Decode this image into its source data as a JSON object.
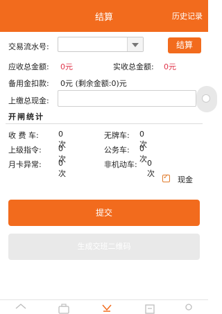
{
  "header": {
    "title": "结算",
    "history": "历史记录"
  },
  "form": {
    "txn_label": "交易流水号:",
    "settle_button": "结算",
    "receivable_label": "应收总金额:",
    "receivable_value": "0元",
    "received_label": "实收总金额:",
    "received_value": "0元",
    "reserve_label": "备用金扣款:",
    "reserve_value": "0元 (剩余金额:0)元",
    "cash_label": "上缴总现金:"
  },
  "stats": {
    "title": "开闸统计",
    "items": [
      {
        "label": "收 费 车:",
        "value": "0次"
      },
      {
        "label": "无牌车:",
        "value": "0次"
      },
      {
        "label": "上级指令:",
        "value": "0次"
      },
      {
        "label": "公务车:",
        "value": "0次"
      },
      {
        "label": "月卡异常:",
        "value": "0次"
      },
      {
        "label": "非机动车:",
        "value": "0次"
      }
    ]
  },
  "cash_checkbox": {
    "label": "现金",
    "checked": true
  },
  "buttons": {
    "submit": "提交",
    "qrcode": "生成交班二维码"
  },
  "tabbar": {
    "icons": [
      "home-icon",
      "camera-icon",
      "settlement-icon",
      "calendar-icon",
      "user-icon"
    ]
  },
  "colors": {
    "accent": "#f26b1d",
    "amount_red": "#e0344a",
    "disabled_button": "#e9e9e9"
  }
}
